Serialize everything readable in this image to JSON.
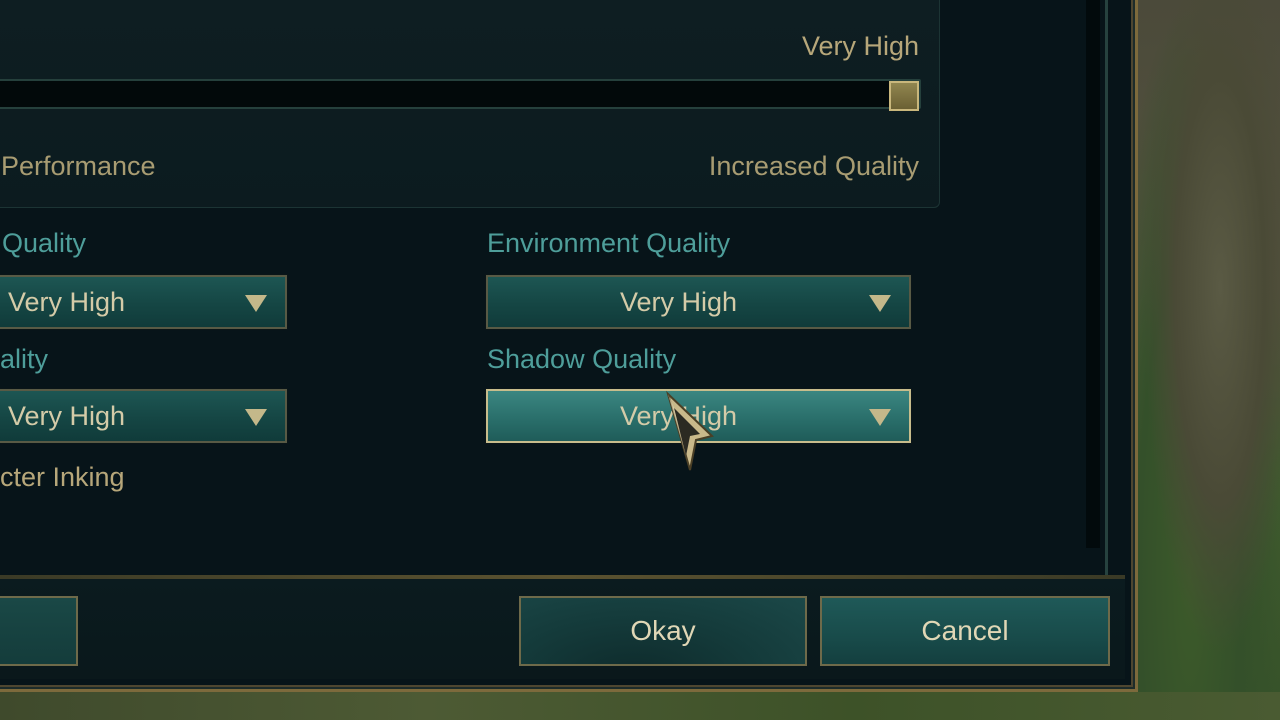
{
  "slider": {
    "value_label": "Very High",
    "left_label": "Performance",
    "right_label": "Increased Quality",
    "level": 1.0
  },
  "settings": {
    "character_quality_label": "Quality",
    "character_quality_value": "Very High",
    "environment_quality_label": "Environment Quality",
    "environment_quality_value": "Very High",
    "effects_quality_label": "ality",
    "effects_quality_value": "Very High",
    "shadow_quality_label": "Shadow Quality",
    "shadow_quality_value": "Very High",
    "character_inking_label": "cter Inking"
  },
  "footer": {
    "okay_label": "Okay",
    "cancel_label": "Cancel"
  },
  "colors": {
    "accent_gold": "#c8aa6e",
    "teal_label": "#4e9e9a",
    "panel_bg": "#071419"
  }
}
